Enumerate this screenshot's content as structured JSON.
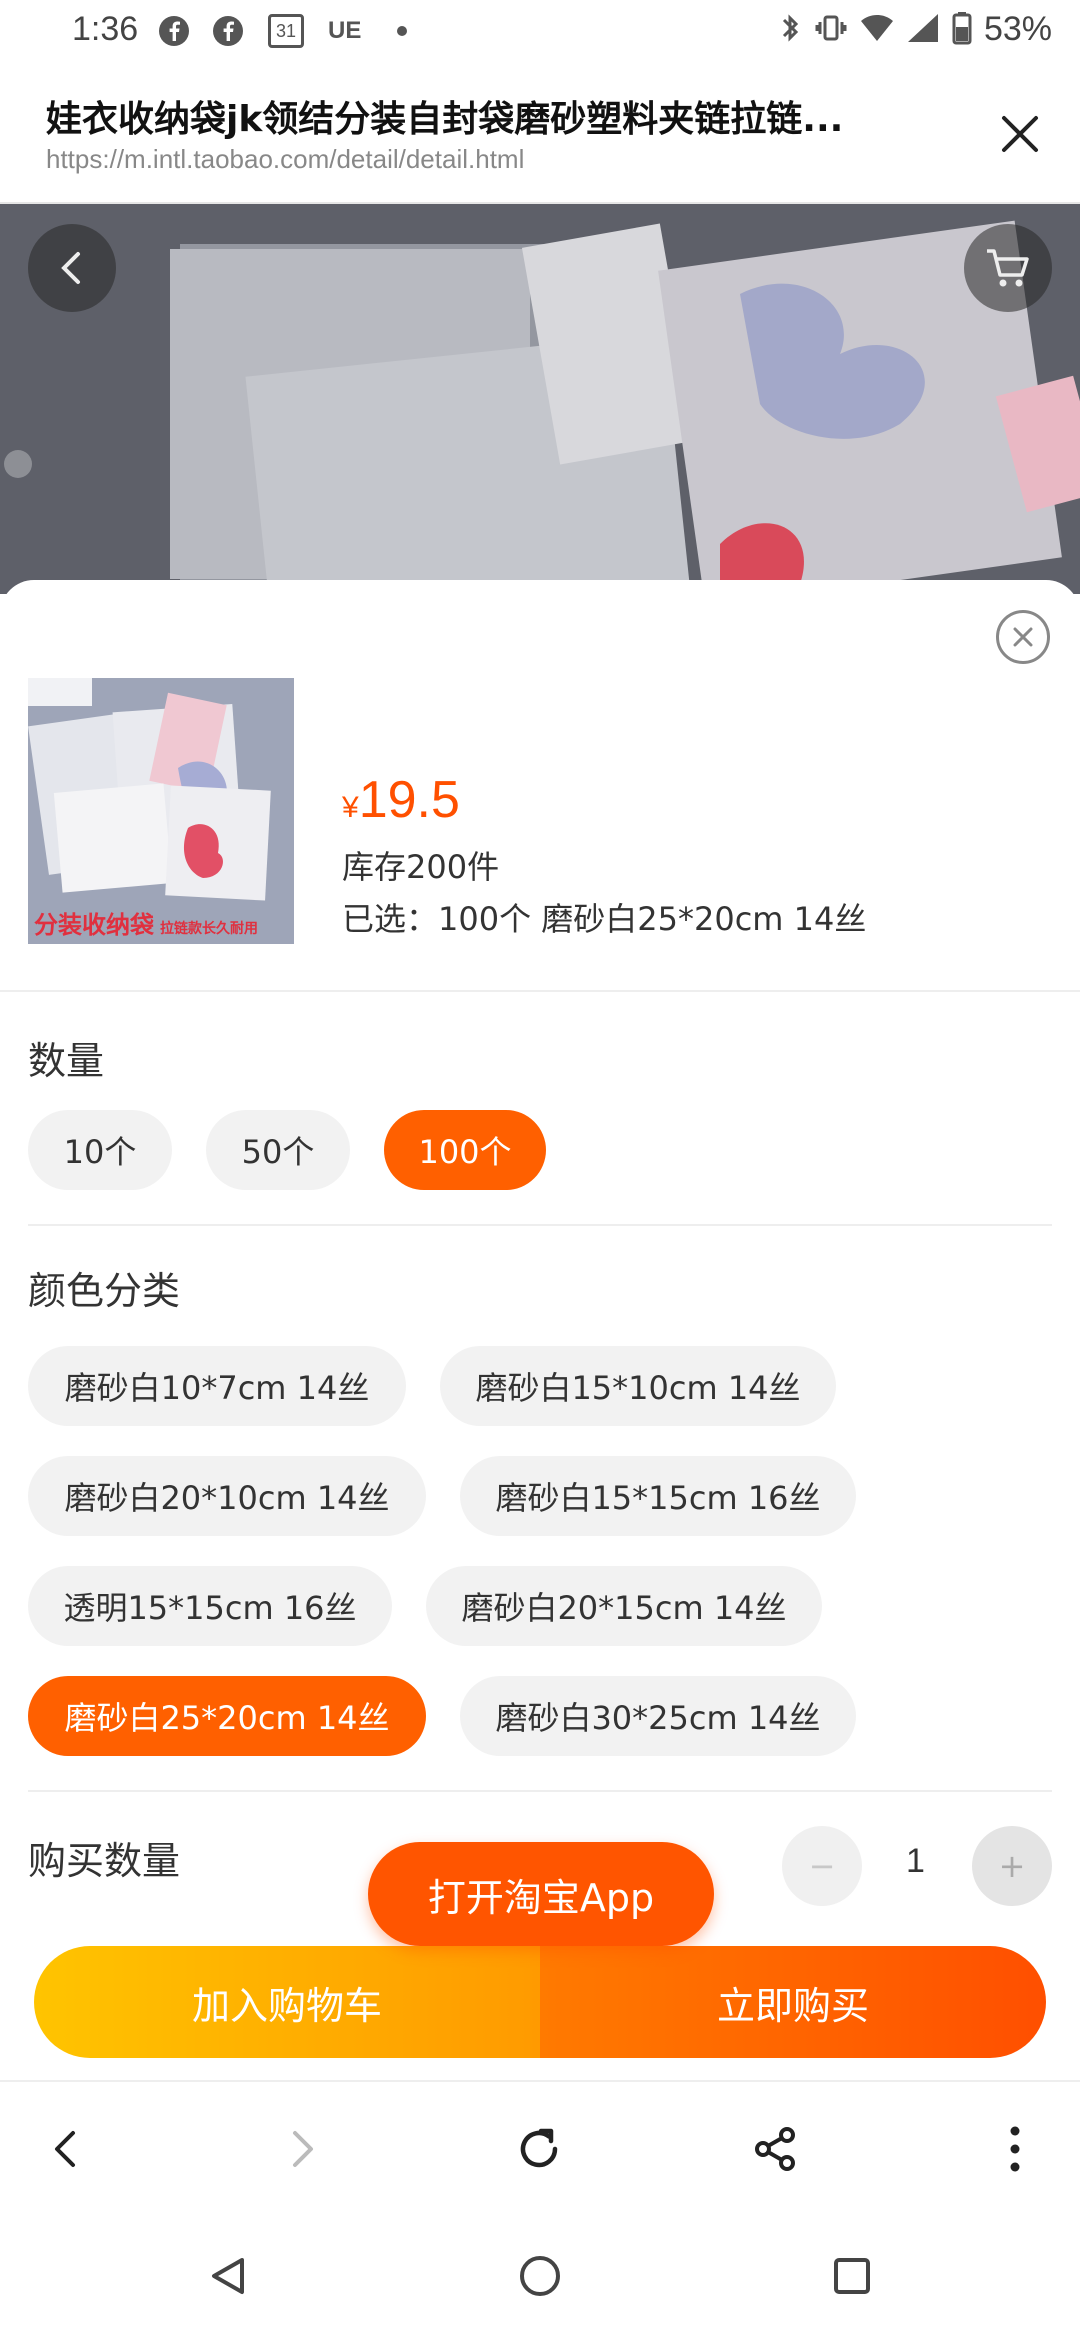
{
  "status_bar": {
    "time": "1:36",
    "left_icons": [
      "facebook-icon",
      "facebook-icon",
      "calendar-icon",
      "UE",
      "dot"
    ],
    "calendar_day": "31",
    "ue_label": "UE",
    "battery": "53%"
  },
  "browser": {
    "page_title": "娃衣收纳袋jk领结分装自封袋磨砂塑料夹链拉链...",
    "url": "https://m.intl.taobao.com/detail/detail.html"
  },
  "product": {
    "currency": "¥",
    "price": "19.5",
    "stock": "库存200件",
    "selected": "已选：100个 磨砂白25*20cm 14丝",
    "thumb_text_1": "分装收纳袋",
    "thumb_text_2": "拉链款长久耐用"
  },
  "quantity_section": {
    "title": "数量",
    "options": [
      "10个",
      "50个",
      "100个"
    ],
    "selected": "100个"
  },
  "color_section": {
    "title": "颜色分类",
    "options": [
      "磨砂白10*7cm 14丝",
      "磨砂白15*10cm 14丝",
      "磨砂白20*10cm 14丝",
      "磨砂白15*15cm 16丝",
      "透明15*15cm 16丝",
      "磨砂白20*15cm 14丝",
      "磨砂白25*20cm 14丝",
      "磨砂白30*25cm 14丝"
    ],
    "selected": "磨砂白25*20cm 14丝"
  },
  "buy_quantity": {
    "label": "购买数量",
    "minus": "−",
    "plus": "+",
    "value": "1"
  },
  "actions": {
    "open_app": "打开淘宝App",
    "add_to_cart": "加入购物车",
    "buy_now": "立即购买"
  },
  "colors": {
    "accent": "#ff5000",
    "active_chip": "#ff6000",
    "cart_gradient": [
      "#ffc400",
      "#ff9a00"
    ],
    "buy_gradient": [
      "#ff7a00",
      "#ff4f00"
    ]
  }
}
